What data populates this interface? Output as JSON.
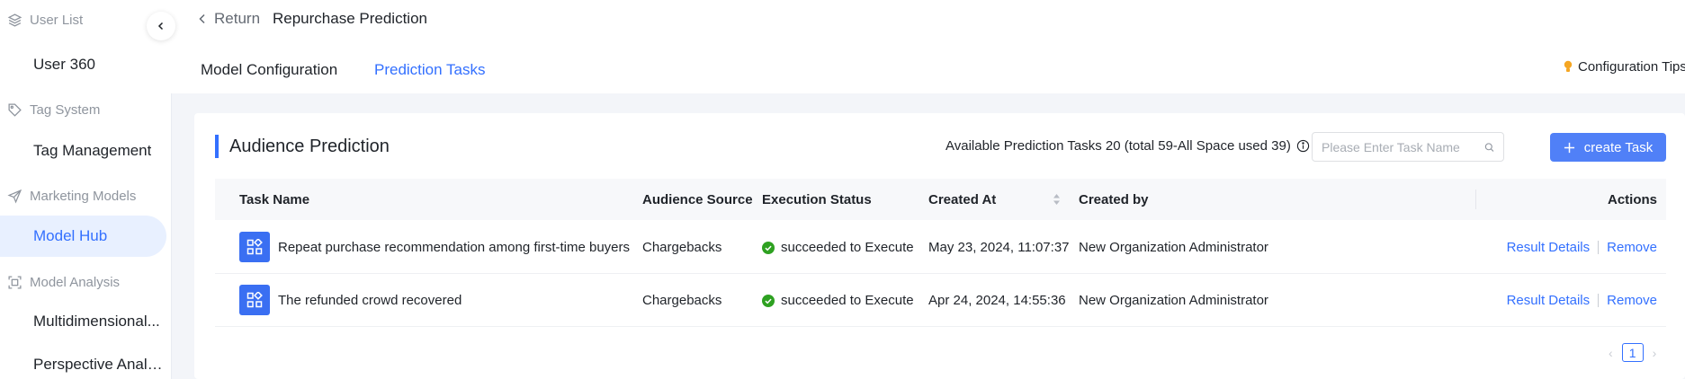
{
  "sidebar": {
    "groups": [
      {
        "title": "User List",
        "icon": "layers-icon",
        "items": [
          "User 360"
        ]
      },
      {
        "title": "Tag System",
        "icon": "tag-icon",
        "items": [
          "Tag Management"
        ]
      },
      {
        "title": "Marketing Models",
        "icon": "send-icon",
        "items": [
          "Model Hub"
        ]
      },
      {
        "title": "Model Analysis",
        "icon": "scan-icon",
        "items": [
          "Multidimensional...",
          "Perspective Analy..."
        ]
      }
    ],
    "active_item": "Model Hub"
  },
  "header": {
    "back_label": "Return",
    "title": "Repurchase Prediction",
    "tabs": [
      {
        "label": "Model Configuration",
        "active": false
      },
      {
        "label": "Prediction Tasks",
        "active": true
      }
    ],
    "tips_label": "Configuration Tips"
  },
  "card": {
    "title": "Audience Prediction",
    "available_text": "Available Prediction Tasks 20 (total 59-All Space used 39)",
    "search_placeholder": "Please Enter Task Name",
    "create_label": "create Task"
  },
  "table": {
    "columns": [
      "Task Name",
      "Audience Source",
      "Execution Status",
      "Created At",
      "Created by",
      "Actions"
    ],
    "rows": [
      {
        "name": "Repeat purchase recommendation among first-time buyers",
        "source": "Chargebacks",
        "status": "succeeded to Execute",
        "created_at": "May 23, 2024, 11:07:37",
        "created_by": "New Organization Administrator",
        "action_details": "Result Details",
        "action_remove": "Remove"
      },
      {
        "name": "The refunded crowd recovered",
        "source": "Chargebacks",
        "status": "succeeded to Execute",
        "created_at": "Apr 24, 2024, 14:55:36",
        "created_by": "New Organization Administrator",
        "action_details": "Result Details",
        "action_remove": "Remove"
      }
    ]
  },
  "pagination": {
    "current_page": "1"
  },
  "colors": {
    "accent": "#3370ff",
    "success": "#2ea121",
    "task_icon": "#3a6ff2"
  }
}
